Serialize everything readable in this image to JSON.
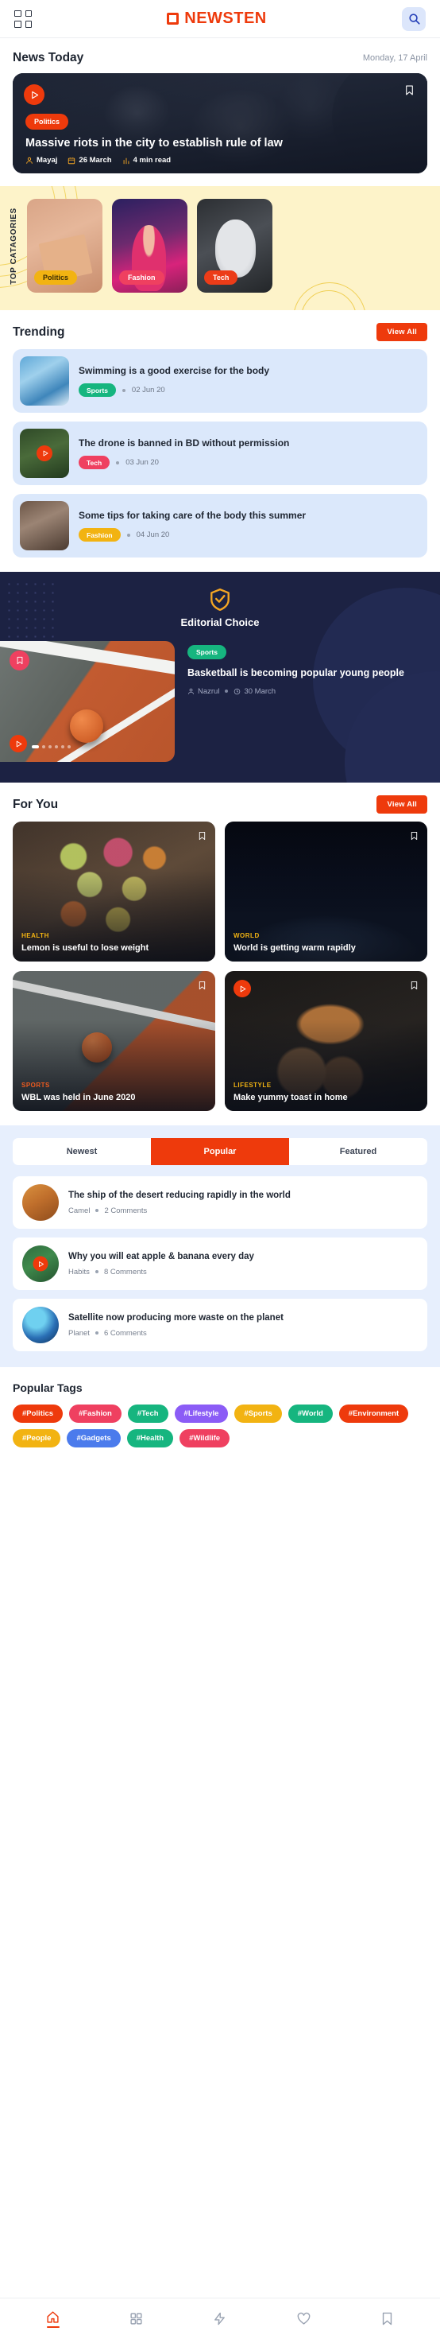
{
  "topbar": {
    "grid_icon": "grid-icon",
    "brand": "NEWSTEN",
    "search_icon": "search-icon"
  },
  "news_today": {
    "title": "News Today",
    "date": "Monday, 17 April",
    "hero": {
      "category": "Politics",
      "title": "Massive riots in the city to establish rule of law",
      "author": "Mayaj",
      "date": "26 March",
      "read_time": "4 min read",
      "play_icon": "play-icon",
      "bookmark_icon": "bookmark-icon"
    }
  },
  "categories": {
    "label": "TOP CATAGORIES",
    "items": [
      {
        "name": "Politics",
        "color": "#f2b312"
      },
      {
        "name": "Fashion",
        "color": "#ef4060"
      },
      {
        "name": "Tech",
        "color": "#ec3c18"
      }
    ]
  },
  "trending": {
    "title": "Trending",
    "view_all": "View All",
    "items": [
      {
        "title": "Swimming is a good exercise for the body",
        "tag": "Sports",
        "tag_color": "#16b57f",
        "date": "02 Jun 20",
        "has_play": false
      },
      {
        "title": "The drone is banned in BD without permission",
        "tag": "Tech",
        "tag_color": "#ef4060",
        "date": "03 Jun 20",
        "has_play": true
      },
      {
        "title": "Some tips for taking care of the body this summer",
        "tag": "Fashion",
        "tag_color": "#f2b312",
        "date": "04 Jun 20",
        "has_play": false
      }
    ]
  },
  "editorial": {
    "badge_icon": "shield-check-icon",
    "title": "Editorial Choice",
    "tag": "Sports",
    "article_title": "Basketball is becoming popular young people",
    "author": "Nazrul",
    "date": "30 March",
    "bookmark_icon": "bookmark-icon",
    "play_icon": "play-icon"
  },
  "for_you": {
    "title": "For You",
    "view_all": "View All",
    "items": [
      {
        "kicker": "HEALTH",
        "title": "Lemon is useful to lose weight",
        "has_play": false
      },
      {
        "kicker": "WORLD",
        "title": "World is getting warm rapidly",
        "has_play": false
      },
      {
        "kicker": "SPORTS",
        "title": "WBL was held in June 2020",
        "has_play": false
      },
      {
        "kicker": "LIFESTYLE",
        "title": "Make yummy toast in home",
        "has_play": true
      }
    ]
  },
  "popular": {
    "tabs": [
      {
        "label": "Newest",
        "active": false
      },
      {
        "label": "Popular",
        "active": true
      },
      {
        "label": "Featured",
        "active": false
      }
    ],
    "items": [
      {
        "title": "The ship of the desert reducing rapidly in the world",
        "source": "Camel",
        "comments": "2 Comments",
        "has_play": false
      },
      {
        "title": "Why you will eat apple & banana every day",
        "source": "Habits",
        "comments": "8 Comments",
        "has_play": true
      },
      {
        "title": "Satellite now producing more waste on the planet",
        "source": "Planet",
        "comments": "6 Comments",
        "has_play": false
      }
    ]
  },
  "tags": {
    "title": "Popular Tags",
    "items": [
      {
        "label": "#Politics",
        "color": "#ee3a0c"
      },
      {
        "label": "#Fashion",
        "color": "#ef4060"
      },
      {
        "label": "#Tech",
        "color": "#16b57f"
      },
      {
        "label": "#Lifestyle",
        "color": "#8b5cf6"
      },
      {
        "label": "#Sports",
        "color": "#f2b312"
      },
      {
        "label": "#World",
        "color": "#16b57f"
      },
      {
        "label": "#Environment",
        "color": "#ee3a0c"
      },
      {
        "label": "#People",
        "color": "#f2b312"
      },
      {
        "label": "#Gadgets",
        "color": "#4b7bec"
      },
      {
        "label": "#Health",
        "color": "#16b57f"
      },
      {
        "label": "#Wildlife",
        "color": "#ef4060"
      }
    ]
  },
  "bottom_nav": {
    "items": [
      {
        "icon": "home-icon",
        "active": true
      },
      {
        "icon": "grid-icon",
        "active": false
      },
      {
        "icon": "flash-icon",
        "active": false
      },
      {
        "icon": "heart-icon",
        "active": false
      },
      {
        "icon": "bookmark-icon",
        "active": false
      }
    ]
  }
}
